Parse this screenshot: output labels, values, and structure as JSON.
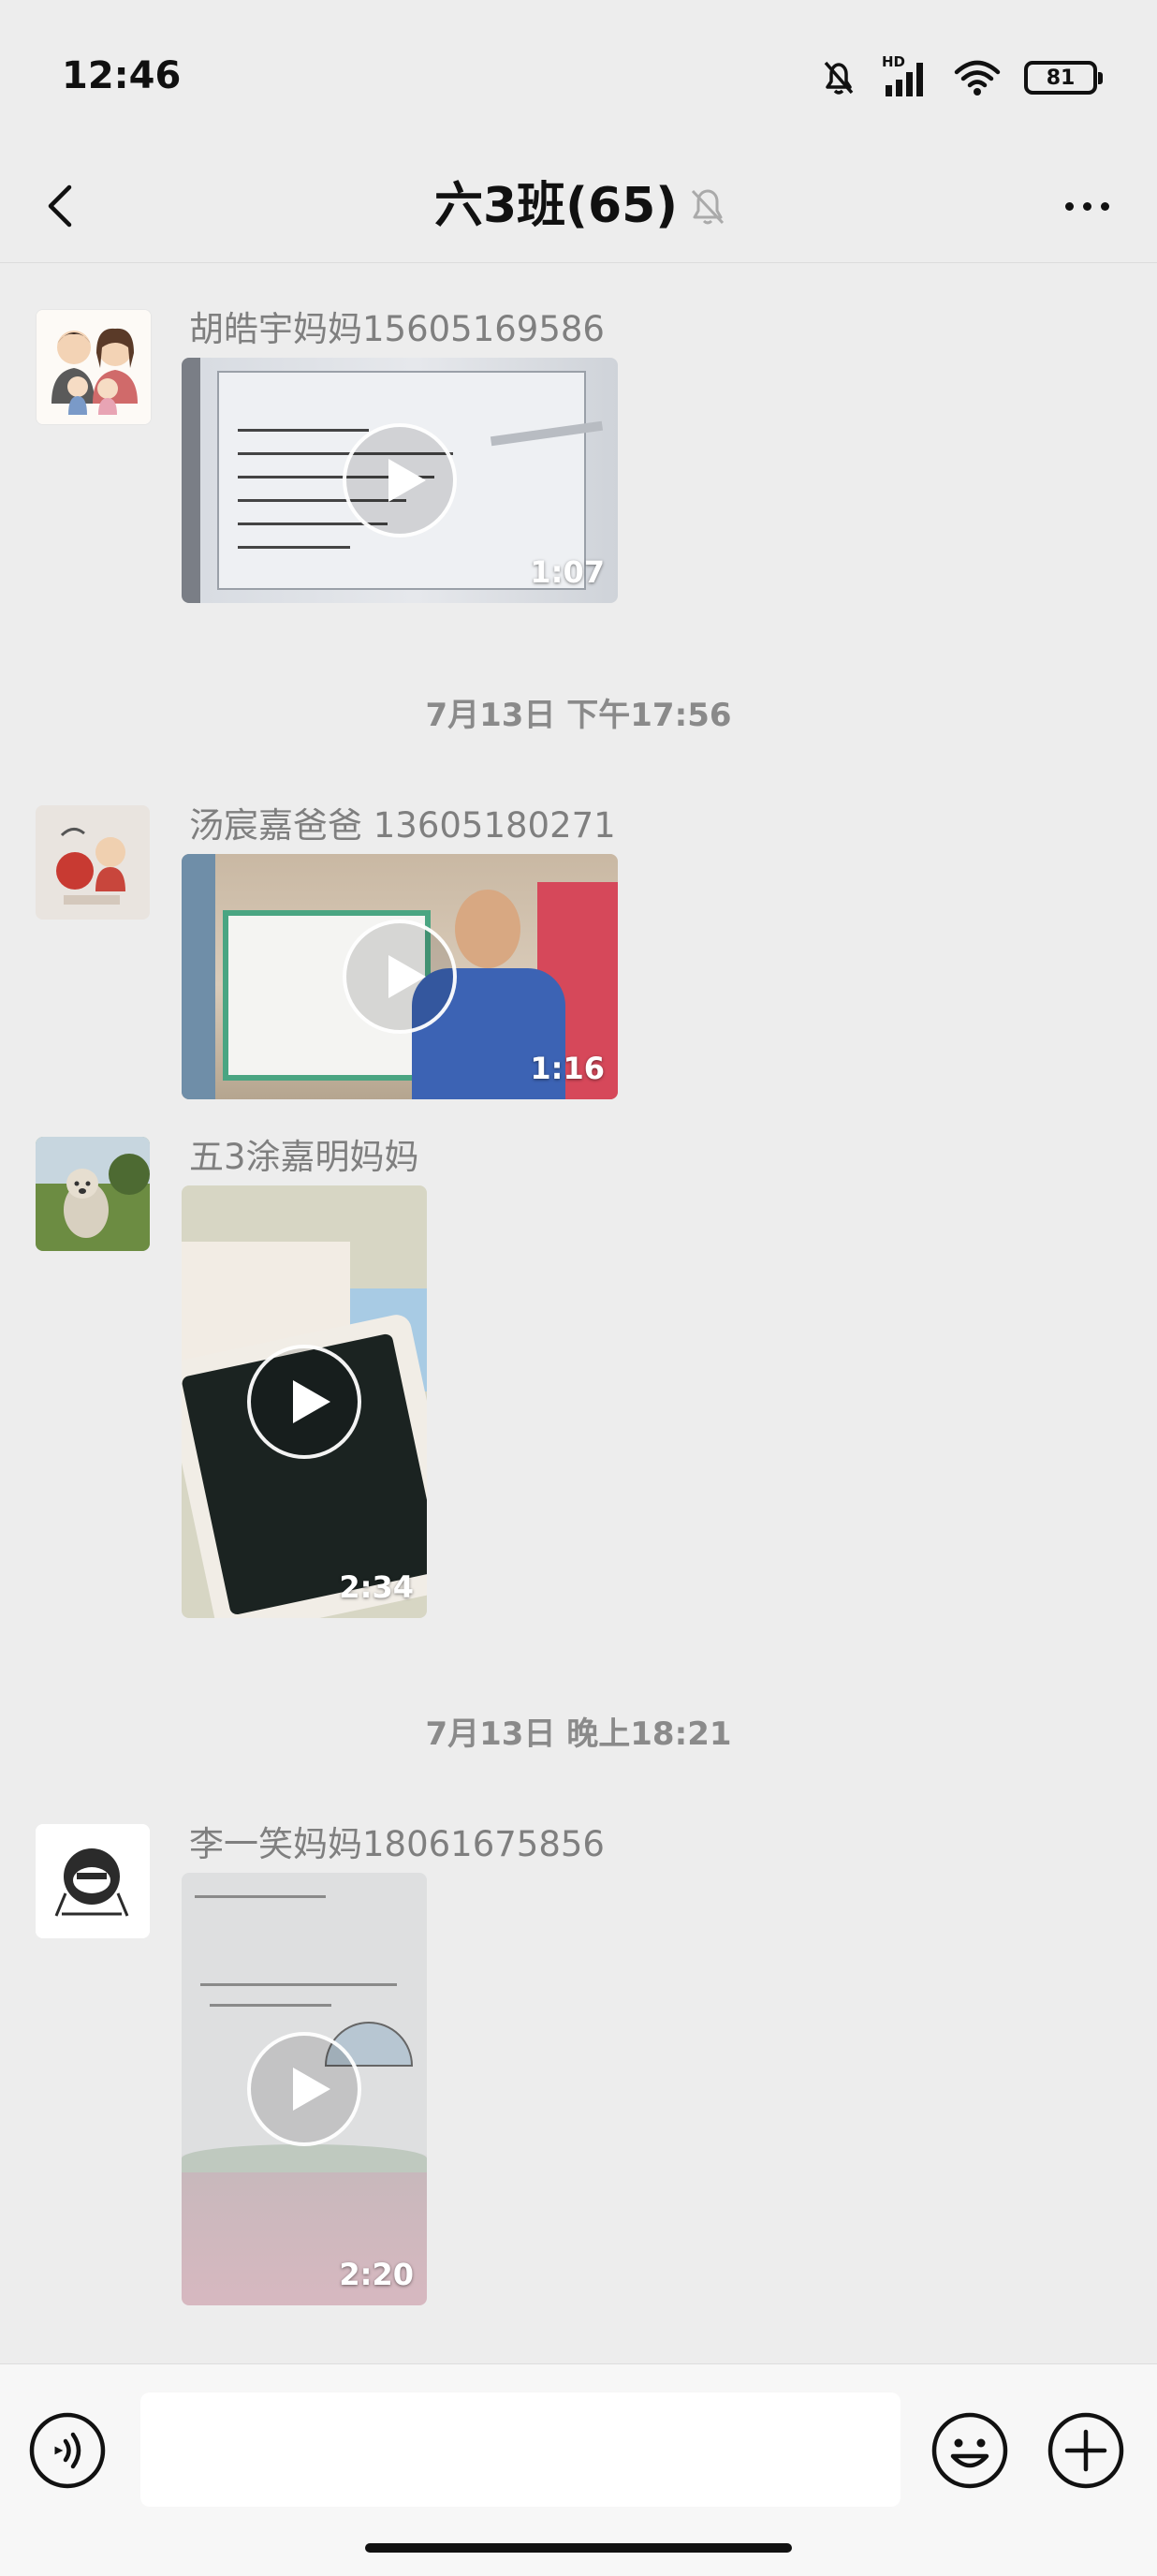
{
  "status_bar": {
    "time": "12:46",
    "network_label": "HD",
    "battery": "81",
    "icons": [
      "bell-muted-icon",
      "signal-icon",
      "wifi-icon",
      "battery-icon"
    ]
  },
  "header": {
    "title": "六3班(65)",
    "icons": [
      "back-arrow-icon",
      "bell-muted-icon",
      "more-dots-icon"
    ]
  },
  "messages": [
    {
      "sender": "胡皓宇妈妈15605169586",
      "type": "video",
      "duration": "1:07"
    },
    {
      "timestamp": "7月13日 下午17:56"
    },
    {
      "sender": "汤宸嘉爸爸 13605180271",
      "type": "video",
      "duration": "1:16"
    },
    {
      "sender": "五3涂嘉明妈妈",
      "type": "video",
      "duration": "2:34"
    },
    {
      "timestamp": "7月13日 晚上18:21"
    },
    {
      "sender": "李一笑妈妈18061675856",
      "type": "video",
      "duration": "2:20"
    }
  ],
  "input_bar": {
    "value": "",
    "icons": [
      "voice-icon",
      "emoji-icon",
      "plus-icon"
    ]
  }
}
